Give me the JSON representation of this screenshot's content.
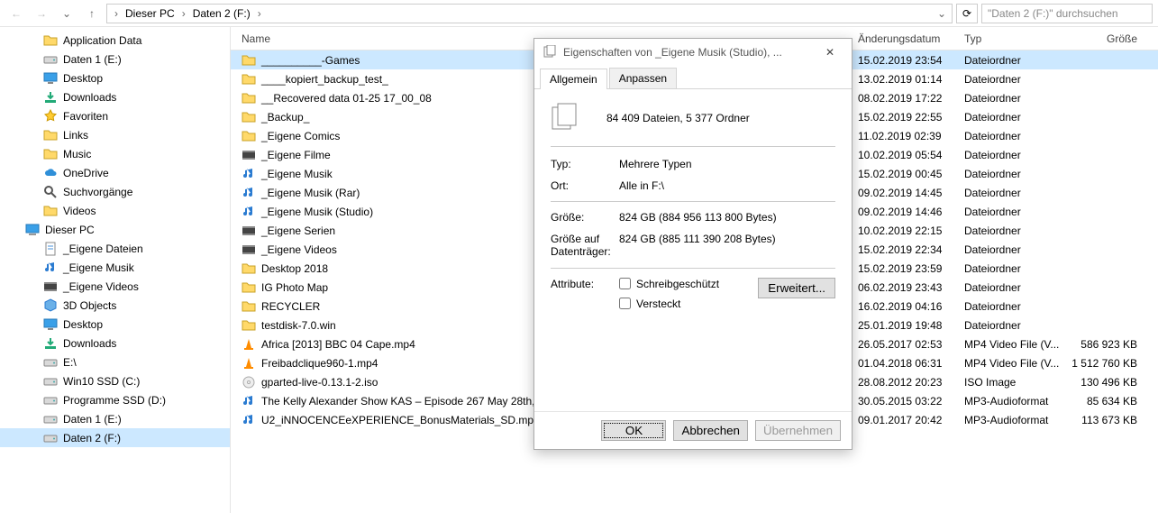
{
  "nav": {
    "back": "←",
    "forward": "→",
    "up": "↑",
    "refresh": "⟳",
    "dropdown": "⌄"
  },
  "breadcrumb": {
    "pc": "Dieser PC",
    "drive": "Daten 2 (F:)"
  },
  "search": {
    "placeholder": "\"Daten 2 (F:)\" durchsuchen"
  },
  "tree": [
    {
      "icon": "folder",
      "label": "Application Data",
      "depth": 1
    },
    {
      "icon": "drive",
      "label": "Daten 1 (E:)",
      "depth": 1
    },
    {
      "icon": "desktop",
      "label": "Desktop",
      "depth": 1
    },
    {
      "icon": "download",
      "label": "Downloads",
      "depth": 1
    },
    {
      "icon": "star",
      "label": "Favoriten",
      "depth": 1
    },
    {
      "icon": "folder",
      "label": "Links",
      "depth": 1
    },
    {
      "icon": "folder",
      "label": "Music",
      "depth": 1
    },
    {
      "icon": "cloud",
      "label": "OneDrive",
      "depth": 1
    },
    {
      "icon": "search",
      "label": "Suchvorgänge",
      "depth": 1
    },
    {
      "icon": "folder",
      "label": "Videos",
      "depth": 1
    },
    {
      "icon": "pc",
      "label": "Dieser PC",
      "depth": 0
    },
    {
      "icon": "doc",
      "label": "_Eigene Dateien",
      "depth": 1
    },
    {
      "icon": "music",
      "label": "_Eigene Musik",
      "depth": 1
    },
    {
      "icon": "video",
      "label": "_Eigene Videos",
      "depth": 1
    },
    {
      "icon": "obj",
      "label": "3D Objects",
      "depth": 1
    },
    {
      "icon": "desktop",
      "label": "Desktop",
      "depth": 1
    },
    {
      "icon": "download",
      "label": "Downloads",
      "depth": 1
    },
    {
      "icon": "drive",
      "label": "E:\\",
      "depth": 1
    },
    {
      "icon": "drive",
      "label": "Win10 SSD (C:)",
      "depth": 1
    },
    {
      "icon": "drive",
      "label": "Programme SSD (D:)",
      "depth": 1
    },
    {
      "icon": "drive",
      "label": "Daten 1 (E:)",
      "depth": 1
    },
    {
      "icon": "drive",
      "label": "Daten 2 (F:)",
      "depth": 1,
      "selected": true
    }
  ],
  "columns": {
    "name": "Name",
    "date": "Änderungsdatum",
    "type": "Typ",
    "size": "Größe"
  },
  "rows": [
    {
      "icon": "folder",
      "name": "__________-Games",
      "date": "15.02.2019 23:54",
      "type": "Dateiordner",
      "size": "",
      "sel": true
    },
    {
      "icon": "folder",
      "name": "____kopiert_backup_test_",
      "date": "13.02.2019 01:14",
      "type": "Dateiordner",
      "size": ""
    },
    {
      "icon": "folder",
      "name": "__Recovered data 01-25 17_00_08",
      "date": "08.02.2019 17:22",
      "type": "Dateiordner",
      "size": ""
    },
    {
      "icon": "folder",
      "name": "_Backup_",
      "date": "15.02.2019 22:55",
      "type": "Dateiordner",
      "size": ""
    },
    {
      "icon": "folder",
      "name": "_Eigene Comics",
      "date": "11.02.2019 02:39",
      "type": "Dateiordner",
      "size": ""
    },
    {
      "icon": "video",
      "name": "_Eigene Filme",
      "date": "10.02.2019 05:54",
      "type": "Dateiordner",
      "size": ""
    },
    {
      "icon": "music",
      "name": "_Eigene Musik",
      "date": "15.02.2019 00:45",
      "type": "Dateiordner",
      "size": ""
    },
    {
      "icon": "music",
      "name": "_Eigene Musik (Rar)",
      "date": "09.02.2019 14:45",
      "type": "Dateiordner",
      "size": ""
    },
    {
      "icon": "music",
      "name": "_Eigene Musik (Studio)",
      "date": "09.02.2019 14:46",
      "type": "Dateiordner",
      "size": ""
    },
    {
      "icon": "video",
      "name": "_Eigene Serien",
      "date": "10.02.2019 22:15",
      "type": "Dateiordner",
      "size": ""
    },
    {
      "icon": "video",
      "name": "_Eigene Videos",
      "date": "15.02.2019 22:34",
      "type": "Dateiordner",
      "size": ""
    },
    {
      "icon": "folder",
      "name": "Desktop 2018",
      "date": "15.02.2019 23:59",
      "type": "Dateiordner",
      "size": ""
    },
    {
      "icon": "folder",
      "name": "IG Photo Map",
      "date": "06.02.2019 23:43",
      "type": "Dateiordner",
      "size": ""
    },
    {
      "icon": "folder",
      "name": "RECYCLER",
      "date": "16.02.2019 04:16",
      "type": "Dateiordner",
      "size": ""
    },
    {
      "icon": "folder",
      "name": "testdisk-7.0.win",
      "date": "25.01.2019 19:48",
      "type": "Dateiordner",
      "size": ""
    },
    {
      "icon": "vlc",
      "name": "Africa [2013] BBC 04 Cape.mp4",
      "date": "26.05.2017 02:53",
      "type": "MP4 Video File (V...",
      "size": "586 923 KB"
    },
    {
      "icon": "vlc",
      "name": "Freibadclique960-1.mp4",
      "date": "01.04.2018 06:31",
      "type": "MP4 Video File (V...",
      "size": "1 512 760 KB"
    },
    {
      "icon": "disc",
      "name": "gparted-live-0.13.1-2.iso",
      "date": "28.08.2012 20:23",
      "type": "ISO Image",
      "size": "130 496 KB"
    },
    {
      "icon": "music",
      "name": "The Kelly Alexander Show KAS – Episode 267 May 28th, 2...",
      "date": "30.05.2015 03:22",
      "type": "MP3-Audioformat",
      "size": "85 634 KB"
    },
    {
      "icon": "music",
      "name": "U2_iNNOCENCEeXPERIENCE_BonusMaterials_SD.mp3",
      "date": "09.01.2017 20:42",
      "type": "MP3-Audioformat",
      "size": "113 673 KB"
    }
  ],
  "dialog": {
    "title": "Eigenschaften von _Eigene Musik (Studio), ...",
    "tabs": {
      "general": "Allgemein",
      "custom": "Anpassen"
    },
    "summary": "84 409 Dateien, 5 377 Ordner",
    "fields": {
      "type_label": "Typ:",
      "type_value": "Mehrere Typen",
      "loc_label": "Ort:",
      "loc_value": "Alle in F:\\",
      "size_label": "Größe:",
      "size_value": "824 GB (884 956 113 800 Bytes)",
      "disk_label": "Größe auf Datenträger:",
      "disk_value": "824 GB (885 111 390 208 Bytes)",
      "attr_label": "Attribute:",
      "ro_label": "Schreibgeschützt",
      "hidden_label": "Versteckt",
      "advanced": "Erweitert..."
    },
    "buttons": {
      "ok": "OK",
      "cancel": "Abbrechen",
      "apply": "Übernehmen"
    }
  }
}
